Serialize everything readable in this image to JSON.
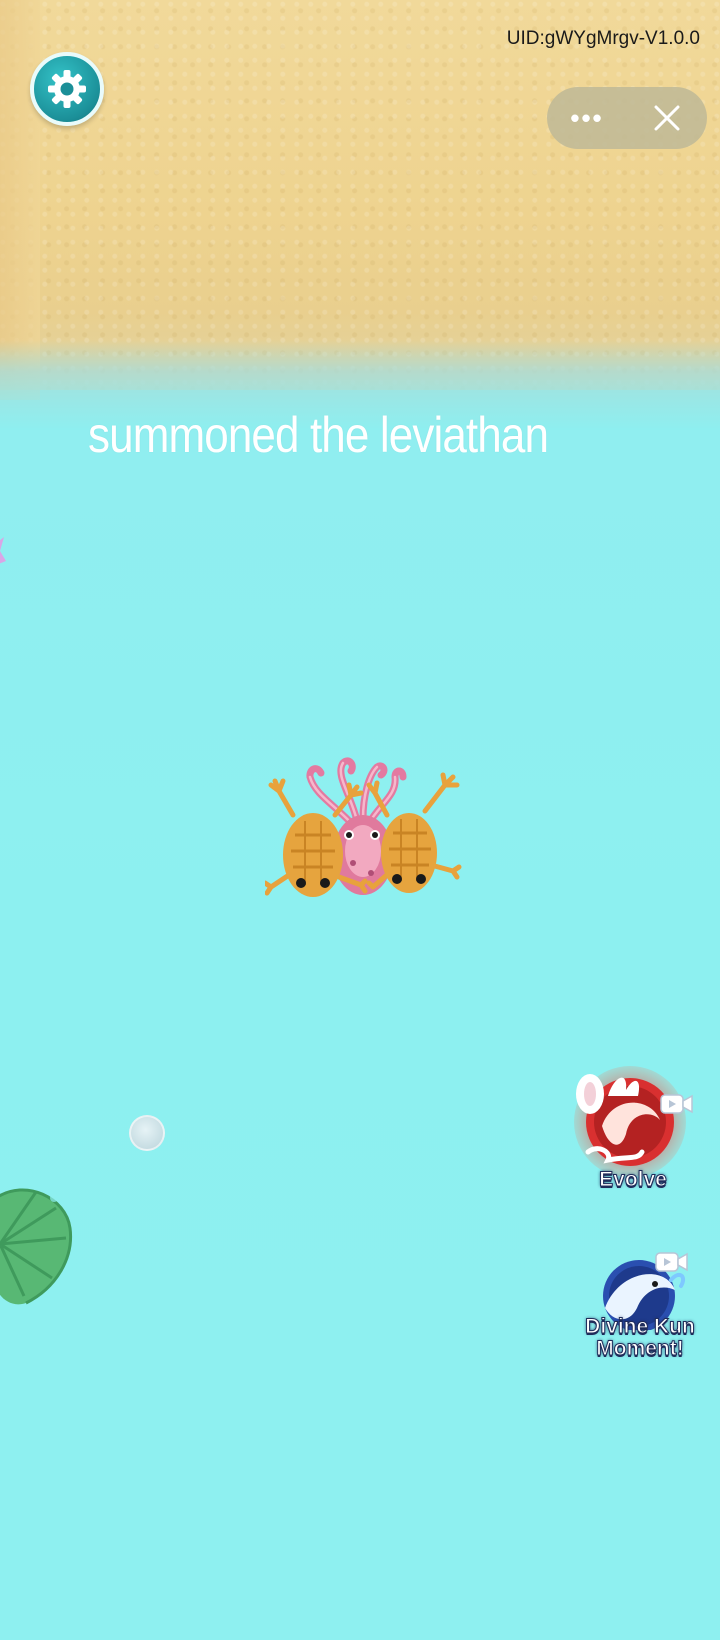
{
  "hud": {
    "uid": "UID:gWYgMrgv-V1.0.0",
    "more_symbol": "•••",
    "status_message": "summoned the leviathan"
  },
  "actions": {
    "evolve_label": "Evolve",
    "divine_label_line1": "Divine Kun",
    "divine_label_line2": "Moment!"
  },
  "icons": {
    "settings": "gear-icon",
    "more": "more-dots-icon",
    "close": "close-icon",
    "video": "video-camera-icon"
  },
  "colors": {
    "water": "#8eeff0",
    "sand": "#eed38f",
    "settings_button": "#1b8f98",
    "capsule": "#bfb996"
  }
}
